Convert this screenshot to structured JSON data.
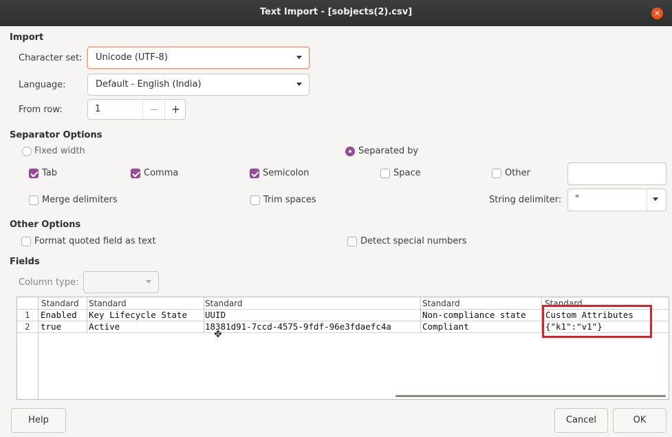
{
  "window": {
    "title": "Text Import - [sobjects(2).csv]"
  },
  "import": {
    "section_label": "Import",
    "charset_label": "Character set:",
    "charset_value": "Unicode (UTF-8)",
    "language_label": "Language:",
    "language_value": "Default - English (India)",
    "from_row_label": "From row:",
    "from_row_value": "1",
    "minus": "−",
    "plus": "+"
  },
  "separator": {
    "section_label": "Separator Options",
    "fixed_width": {
      "label": "Fixed width",
      "selected": false
    },
    "separated_by": {
      "label": "Separated by",
      "selected": true
    },
    "tab": {
      "label": "Tab",
      "checked": true
    },
    "comma": {
      "label": "Comma",
      "checked": true
    },
    "semicolon": {
      "label": "Semicolon",
      "checked": true
    },
    "space": {
      "label": "Space",
      "checked": false
    },
    "other": {
      "label": "Other",
      "checked": false,
      "value": ""
    },
    "merge_delimiters": {
      "label": "Merge delimiters",
      "checked": false
    },
    "trim_spaces": {
      "label": "Trim spaces",
      "checked": false
    },
    "string_delimiter_label": "String delimiter:",
    "string_delimiter_value": "\""
  },
  "other_options": {
    "section_label": "Other Options",
    "format_quoted": {
      "label": "Format quoted field as text",
      "checked": false
    },
    "detect_special": {
      "label": "Detect special numbers",
      "checked": false
    }
  },
  "fields": {
    "section_label": "Fields",
    "column_type_label": "Column type:",
    "column_type_value": "",
    "headers": [
      "Standard",
      "Standard",
      "Standard",
      "Standard",
      "Standard"
    ],
    "rows": [
      {
        "num": "1",
        "cells": [
          "Enabled",
          "Key Lifecycle State",
          "UUID",
          "Non-compliance state",
          "Custom Attributes"
        ]
      },
      {
        "num": "2",
        "cells": [
          "true",
          "Active",
          "18381d91-7ccd-4575-9fdf-96e3fdaefc4a",
          "Compliant",
          "{\"k1\":\"v1\"}"
        ]
      }
    ]
  },
  "buttons": {
    "help": "Help",
    "cancel": "Cancel",
    "ok": "OK"
  },
  "colors": {
    "accent": "#9b4b9c",
    "close": "#e95420",
    "highlight": "#d6232c"
  }
}
